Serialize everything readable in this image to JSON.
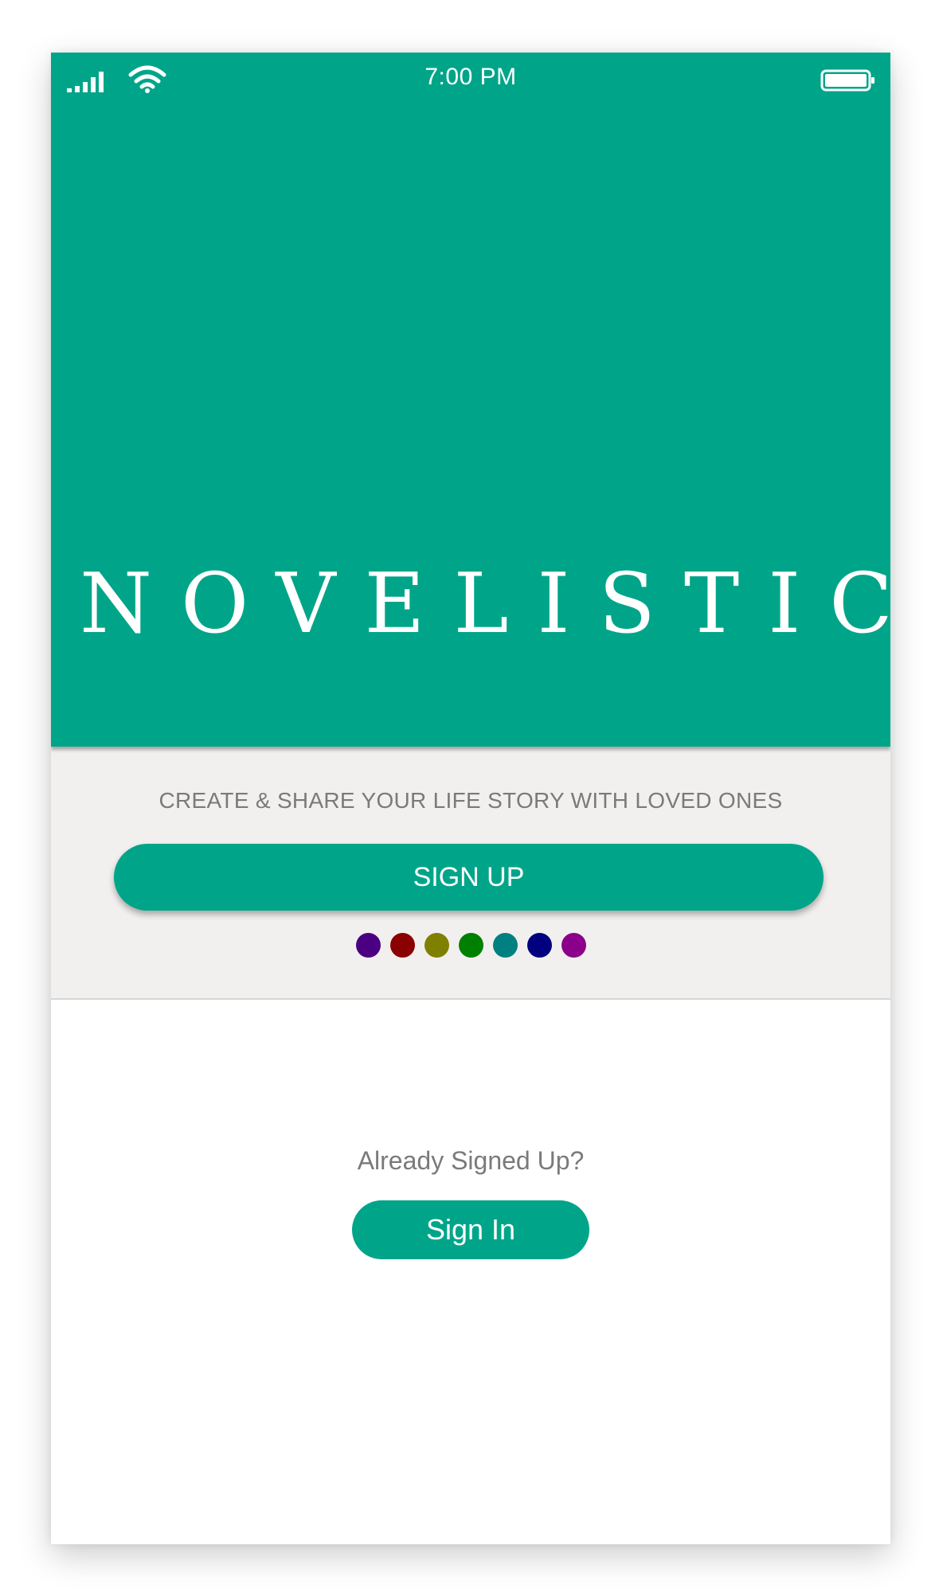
{
  "theme": {
    "accent": "#00a589",
    "band_background": "#f2f0ef",
    "muted_text": "#7a7a7a"
  },
  "status_bar": {
    "time": "7:00 PM",
    "icons": [
      "signal-icon",
      "wifi-icon",
      "battery-icon"
    ]
  },
  "hero": {
    "logo_text": "NOVELISTIC"
  },
  "band": {
    "tagline": "CREATE & SHARE YOUR LIFE STORY WITH LOVED ONES",
    "signup_label": "SIGN UP",
    "color_dots": [
      "#4b0082",
      "#8b0000",
      "#808000",
      "#008000",
      "#008080",
      "#000080",
      "#8b008b"
    ]
  },
  "signin": {
    "prompt": "Already Signed Up?",
    "button_label": "Sign In"
  }
}
